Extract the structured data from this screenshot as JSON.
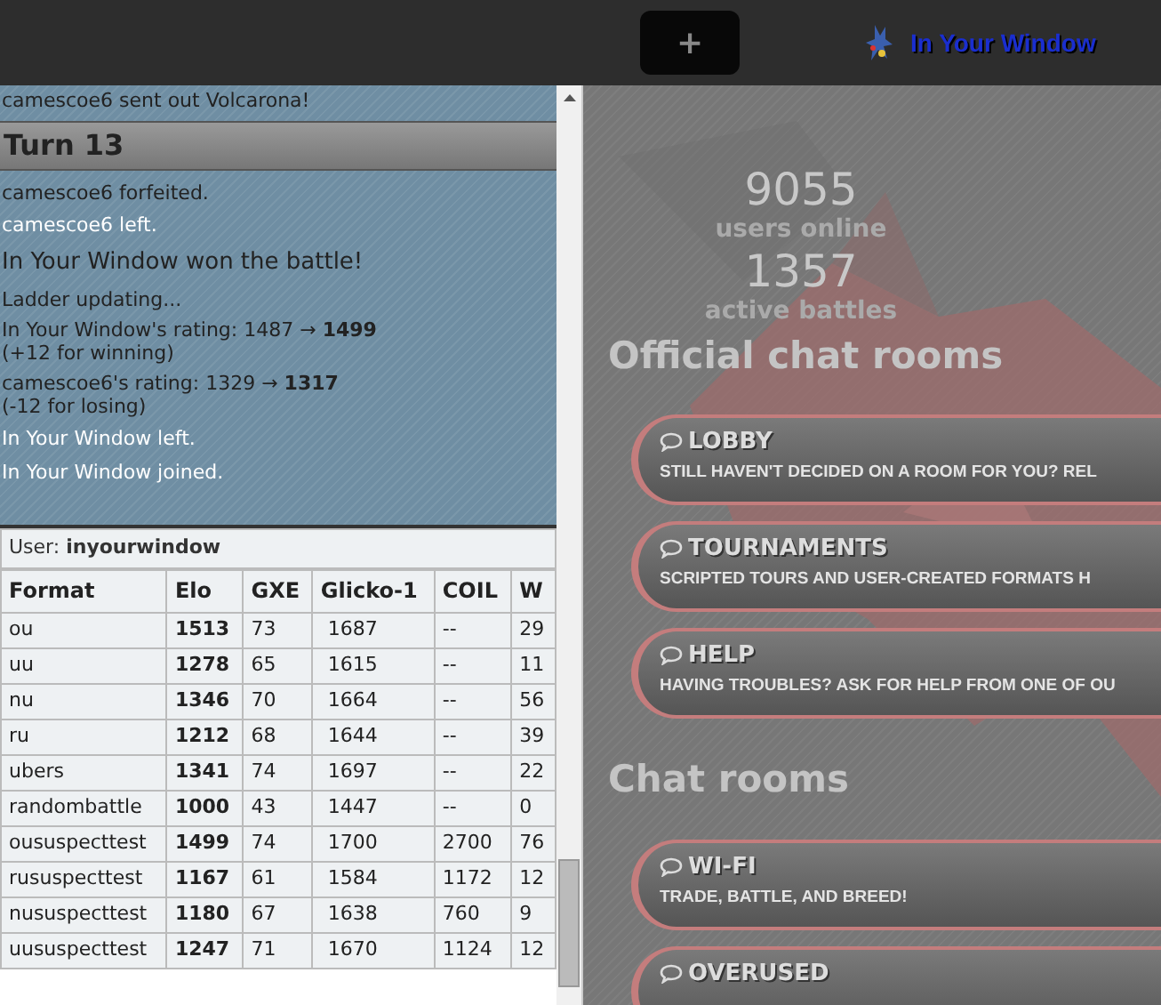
{
  "header": {
    "new_tab_button": "+",
    "user_name": "In Your Window"
  },
  "battle_log": [
    {
      "kind": "battle",
      "text": "camescoe6 sent out Volcarona!"
    },
    {
      "kind": "turn",
      "text": "Turn 13"
    },
    {
      "kind": "battle",
      "text": "camescoe6 forfeited."
    },
    {
      "kind": "chat",
      "text": "camescoe6 left."
    },
    {
      "kind": "big",
      "text": "In Your Window won the battle!"
    },
    {
      "kind": "battle",
      "text": "Ladder updating..."
    },
    {
      "kind": "rating",
      "text": "In Your Window's rating: 1487 → **1499**",
      "note": "(+12 for winning)"
    },
    {
      "kind": "rating",
      "text": "camescoe6's rating: 1329 → **1317**",
      "note": "(-12 for losing)"
    },
    {
      "kind": "chat",
      "text": "In Your Window left."
    },
    {
      "kind": "chat",
      "text": "In Your Window joined."
    }
  ],
  "ladder": {
    "user_label": "User: **inyourwindow**",
    "columns": [
      "Format",
      "Elo",
      "GXE",
      "Glicko-1",
      "COIL",
      "W"
    ],
    "rows": [
      [
        "ou",
        "1513",
        "73",
        "1687",
        "--",
        "29"
      ],
      [
        "uu",
        "1278",
        "65",
        "1615",
        "--",
        "11"
      ],
      [
        "nu",
        "1346",
        "70",
        "1664",
        "--",
        "56"
      ],
      [
        "ru",
        "1212",
        "68",
        "1644",
        "--",
        "39"
      ],
      [
        "ubers",
        "1341",
        "74",
        "1697",
        "--",
        "22"
      ],
      [
        "randombattle",
        "1000",
        "43",
        "1447",
        "--",
        "0"
      ],
      [
        "oususpecttest",
        "1499",
        "74",
        "1700",
        "2700",
        "76"
      ],
      [
        "rususpecttest",
        "1167",
        "61",
        "1584",
        "1172",
        "12"
      ],
      [
        "nususpecttest",
        "1180",
        "67",
        "1638",
        "760",
        "9"
      ],
      [
        "uususpecttest",
        "1247",
        "71",
        "1670",
        "1124",
        "12"
      ]
    ]
  },
  "stats": [
    {
      "value": "9055",
      "label": "users online"
    },
    {
      "value": "1357",
      "label": "active battles"
    }
  ],
  "room_sections": [
    {
      "title": "Official chat rooms",
      "rooms": [
        {
          "name": "LOBBY",
          "description": "STILL HAVEN'T DECIDED ON A ROOM FOR YOU? REL"
        },
        {
          "name": "TOURNAMENTS",
          "description": "SCRIPTED TOURS AND USER-CREATED FORMATS H"
        },
        {
          "name": "HELP",
          "description": "HAVING TROUBLES? ASK FOR HELP FROM ONE OF OU"
        }
      ]
    },
    {
      "title": "Chat rooms",
      "rooms": [
        {
          "name": "WI-FI",
          "description": "TRADE, BATTLE, AND BREED!"
        },
        {
          "name": "OVERUSED"
        }
      ]
    }
  ]
}
